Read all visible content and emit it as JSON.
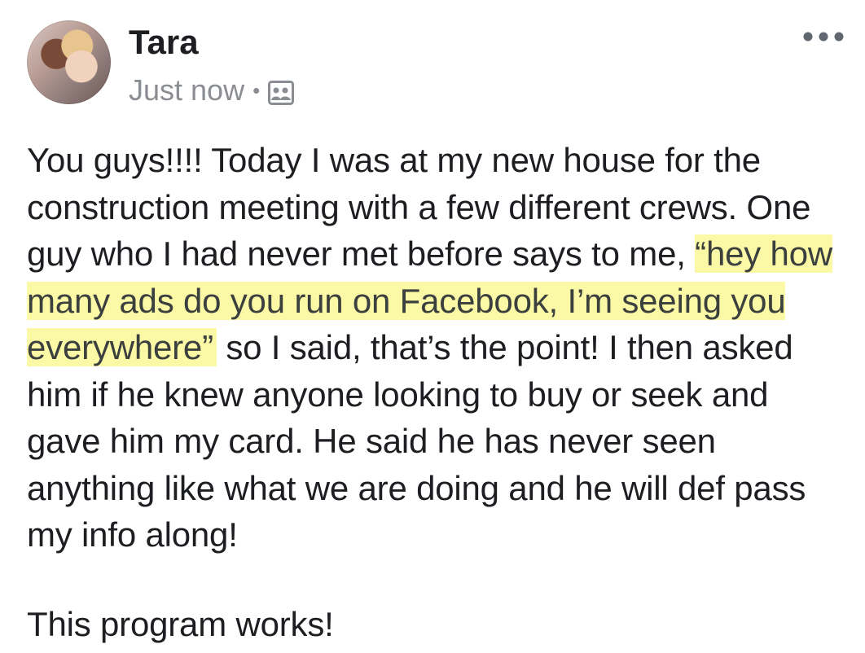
{
  "post": {
    "author": "Tara",
    "timestamp": "Just now",
    "separator": "•",
    "audience_icon": "group-audience-icon",
    "more_icon": "more-options-icon",
    "text_before_highlight": "You guys!!!! Today I was at my new house for the construction meeting with a few different crews. One guy who I had never met before says to me, ",
    "highlighted_quote": "“hey how many ads do you run on Facebook, I’m seeing you everywhere”",
    "text_after_highlight": " so I said, that’s the point! I then asked him if he knew anyone looking to buy or seek and gave him my card. He said he has never seen anything like what we are doing and he will def pass my info along!",
    "closing_line": "This program works!"
  },
  "colors": {
    "text": "#1c1e21",
    "meta": "#8a8d91",
    "highlight": "#fbf9a6"
  }
}
